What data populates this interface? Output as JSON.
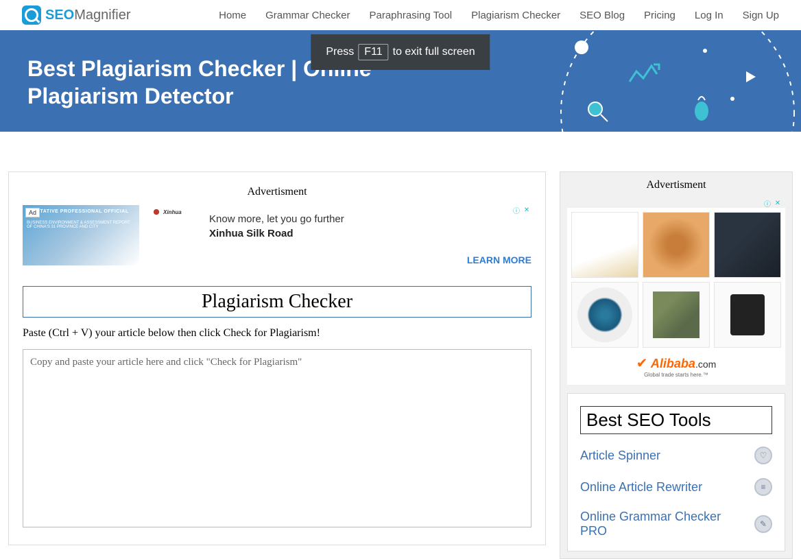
{
  "logo": {
    "seo": "SEO",
    "mag": "Magnifier"
  },
  "nav": [
    "Home",
    "Grammar Checker",
    "Paraphrasing Tool",
    "Plagiarism Checker",
    "SEO Blog",
    "Pricing",
    "Log In",
    "Sign Up"
  ],
  "fullscreen": {
    "pre": "Press",
    "key": "F11",
    "post": "to exit full screen"
  },
  "hero": {
    "title": "Best Plagiarism Checker | Online Plagiarism Detector"
  },
  "ad_label": "Advertisment",
  "ad1": {
    "tag": "Ad",
    "thumb_text": "HORITATIVE PROFESSIONAL OFFICIAL",
    "thumb_sub": "BUSINESS ENVIRONMENT & ASSESSMENT REPORT OF CHINA'S 31 PROVINCE AND CITY",
    "brand": "Xinhua",
    "sub": "Know more, let you go further",
    "title": "Xinhua Silk Road",
    "cta": "LEARN MORE"
  },
  "section": {
    "title": "Plagiarism Checker",
    "instruction": "Paste (Ctrl + V) your article below then click Check for Plagiarism!",
    "placeholder": "Copy and paste your article here and click \"Check for Plagiarism\""
  },
  "alibaba": {
    "name": "Alibaba",
    "suffix": ".com",
    "sub": "Global trade starts here.™"
  },
  "tools": {
    "title": "Best SEO Tools",
    "items": [
      "Article Spinner",
      "Online Article Rewriter",
      "Online Grammar Checker PRO"
    ]
  },
  "tool_icons": [
    "♡",
    "≡",
    "✎"
  ]
}
